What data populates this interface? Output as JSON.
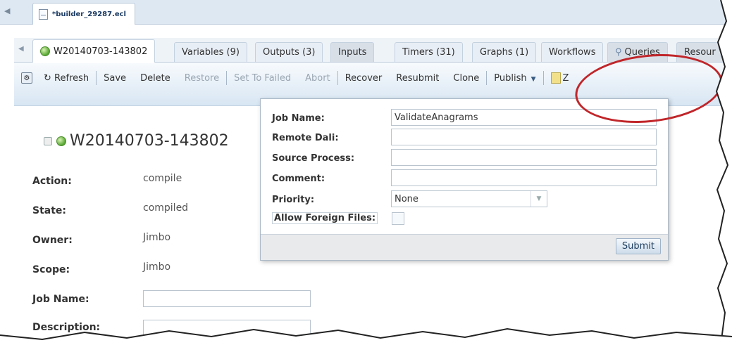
{
  "file_tab": {
    "name": "*builder_29287.ecl",
    "icon": "document-icon"
  },
  "tabs": [
    {
      "label": "W20140703-143802",
      "active": true,
      "icon": "globe-icon"
    },
    {
      "label": "Variables (9)"
    },
    {
      "label": "Outputs (3)"
    },
    {
      "label": "Inputs",
      "grey": true
    },
    {
      "label": "Timers (31)"
    },
    {
      "label": "Graphs (1)"
    },
    {
      "label": "Workflows"
    },
    {
      "label": "Queries",
      "icon": "search-icon"
    },
    {
      "label": "Resour"
    }
  ],
  "toolbar": {
    "refresh": "Refresh",
    "save": "Save",
    "delete": "Delete",
    "restore": "Restore",
    "set_to_failed": "Set To Failed",
    "abort": "Abort",
    "recover": "Recover",
    "resubmit": "Resubmit",
    "clone": "Clone",
    "publish": "Publish",
    "zap": "Z"
  },
  "workunit": {
    "title": "W20140703-143802",
    "fields": [
      {
        "label": "Action:",
        "value": "compile"
      },
      {
        "label": "State:",
        "value": "compiled"
      },
      {
        "label": "Owner:",
        "value": "Jimbo"
      },
      {
        "label": "Scope:",
        "value": "Jimbo"
      }
    ],
    "job_name_label": "Job Name:",
    "description_label": "Description:"
  },
  "publish_form": {
    "job_name_label": "Job Name:",
    "job_name_value": "ValidateAnagrams",
    "remote_dali_label": "Remote Dali:",
    "source_process_label": "Source Process:",
    "comment_label": "Comment:",
    "priority_label": "Priority:",
    "priority_value": "None",
    "allow_foreign_label": "Allow Foreign Files:",
    "submit": "Submit"
  },
  "colors": {
    "annotation": "#c0262a",
    "toolbar_top": "#f7fafd",
    "toolbar_bottom": "#d8e6f3"
  }
}
